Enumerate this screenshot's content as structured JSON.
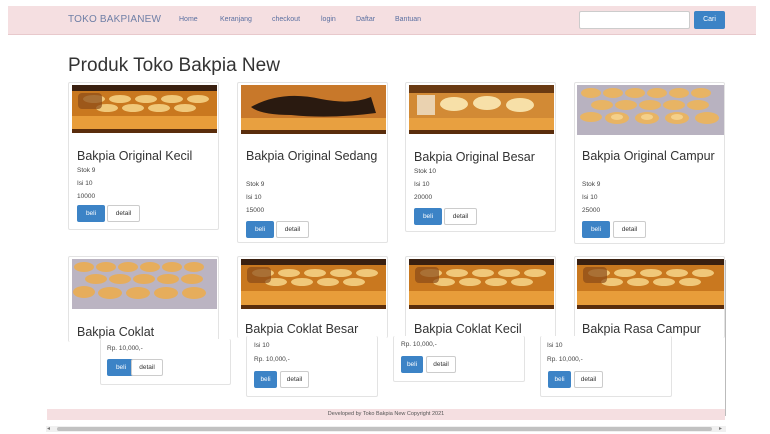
{
  "navbar": {
    "brand": "TOKO BAKPIANEW",
    "links": [
      "Home",
      "Keranjang",
      "checkout",
      "login",
      "Daftar",
      "Bantuan"
    ],
    "search_placeholder": "",
    "search_button": "Cari"
  },
  "page_title": "Produk Toko Bakpia New",
  "products": [
    {
      "name": "Bakpia Original Kecil",
      "stok": "Stok 9",
      "isi": "Isi 10",
      "price": "10000",
      "image": "bakpia-box-image"
    },
    {
      "name": "Bakpia Original Sedang",
      "stok": "Stok 9",
      "isi": "Isi 10",
      "price": "15000",
      "image": "bakpia-box-image"
    },
    {
      "name": "Bakpia Original Besar",
      "stok": "Stok 10",
      "isi": "Isi 10",
      "price": "20000",
      "image": "bakpia-box-image"
    },
    {
      "name": "Bakpia Original Campur",
      "stok": "Stok 9",
      "isi": "Isi 10",
      "price": "25000",
      "image": "bakpia-tray-image"
    },
    {
      "name": "Bakpia Coklat",
      "price": "Rp. 10,000,-",
      "image": "bakpia-tray-image"
    },
    {
      "name": "Bakpia Coklat Besar",
      "isi": "Isi 10",
      "price": "Rp. 10,000,-",
      "image": "bakpia-box-image"
    },
    {
      "name": "Bakpia Coklat Kecil",
      "price": "Rp. 10,000,-",
      "image": "bakpia-box-image"
    },
    {
      "name": "Bakpia Rasa Campur",
      "isi": "Isi 10",
      "price": "Rp. 10,000,-",
      "image": "bakpia-box-image"
    }
  ],
  "buttons": {
    "beli": "beli",
    "detail": "detail"
  },
  "footer": "Developed by Toko Bakpia New Copyright 2021",
  "colors": {
    "navbar_bg": "#f5dfe1",
    "primary": "#3c83c6",
    "brand_text": "#6f7fa6"
  }
}
